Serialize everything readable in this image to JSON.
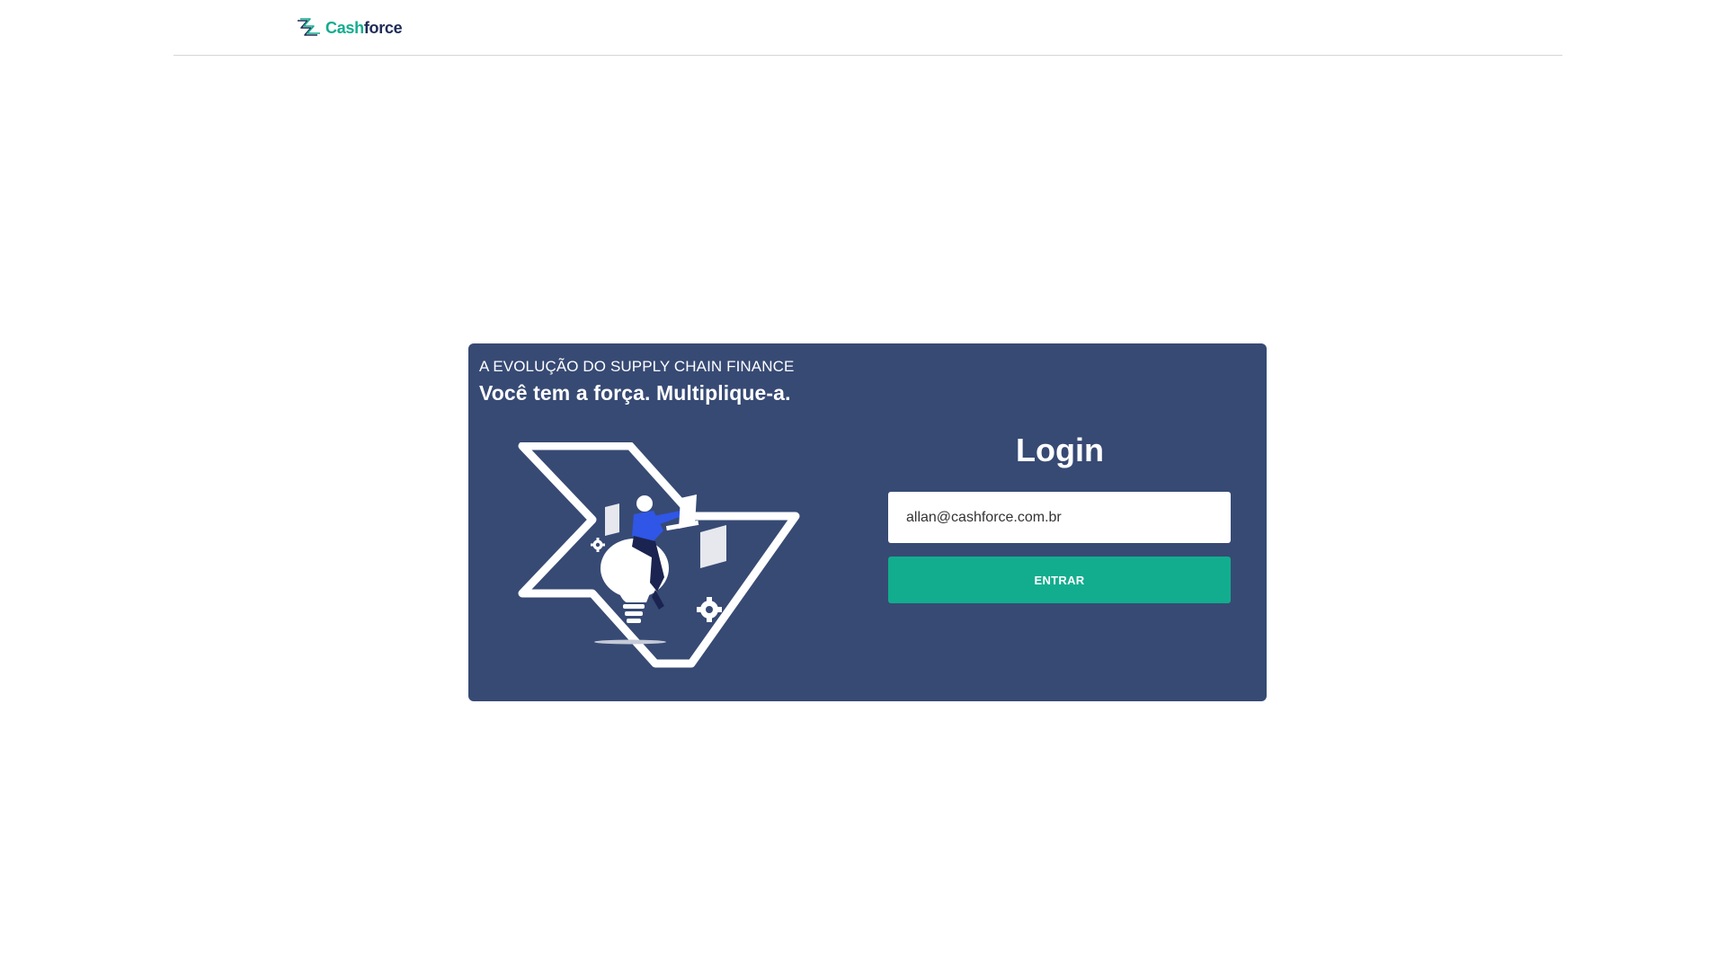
{
  "header": {
    "brand_cash": "Cash",
    "brand_force": "force"
  },
  "hero": {
    "eyebrow": "A EVOLUÇÃO DO SUPPLY CHAIN FINANCE",
    "headline": "Você tem a força. Multiplique-a."
  },
  "login": {
    "title": "Login",
    "email_value": "allan@cashforce.com.br",
    "submit_label": "ENTRAR"
  },
  "colors": {
    "card_background": "#374a74",
    "accent": "#12ad8e",
    "brand_dark": "#1e2b57",
    "figure_blue": "#2f56e6"
  },
  "icons": {
    "logo": "cashforce-logo-icon",
    "illustration": "person-on-lightbulb-illustration"
  }
}
